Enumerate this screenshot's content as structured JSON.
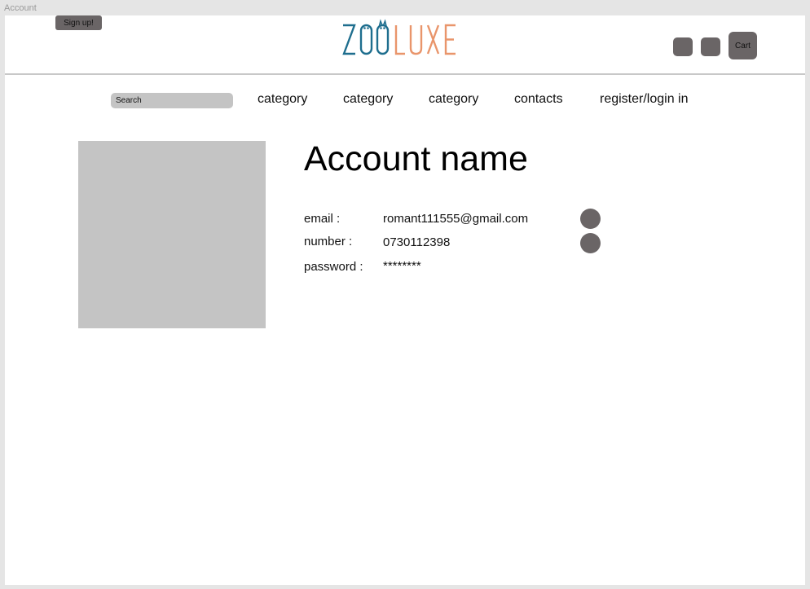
{
  "frame": {
    "label": "Account"
  },
  "header": {
    "signup_label": "Sign up!",
    "logo_text": "ZOOLUXE",
    "icon_buttons": [
      "icon-button",
      "icon-button"
    ],
    "cart_label": "Cart"
  },
  "nav": {
    "search_placeholder": "Search",
    "items": [
      {
        "label": "category"
      },
      {
        "label": "category"
      },
      {
        "label": "category"
      },
      {
        "label": "contacts"
      },
      {
        "label": "register/login in"
      }
    ]
  },
  "account": {
    "title": "Account name",
    "fields": [
      {
        "label": "email :",
        "value": "romant111555@gmail.com"
      },
      {
        "label": "number :",
        "value": "0730112398"
      },
      {
        "label": "password :",
        "value": "********"
      }
    ]
  },
  "colors": {
    "logo_blue": "#1e6e8e",
    "logo_orange": "#e9956b",
    "button_gray": "#6a6566",
    "placeholder_gray": "#c4c4c4"
  }
}
